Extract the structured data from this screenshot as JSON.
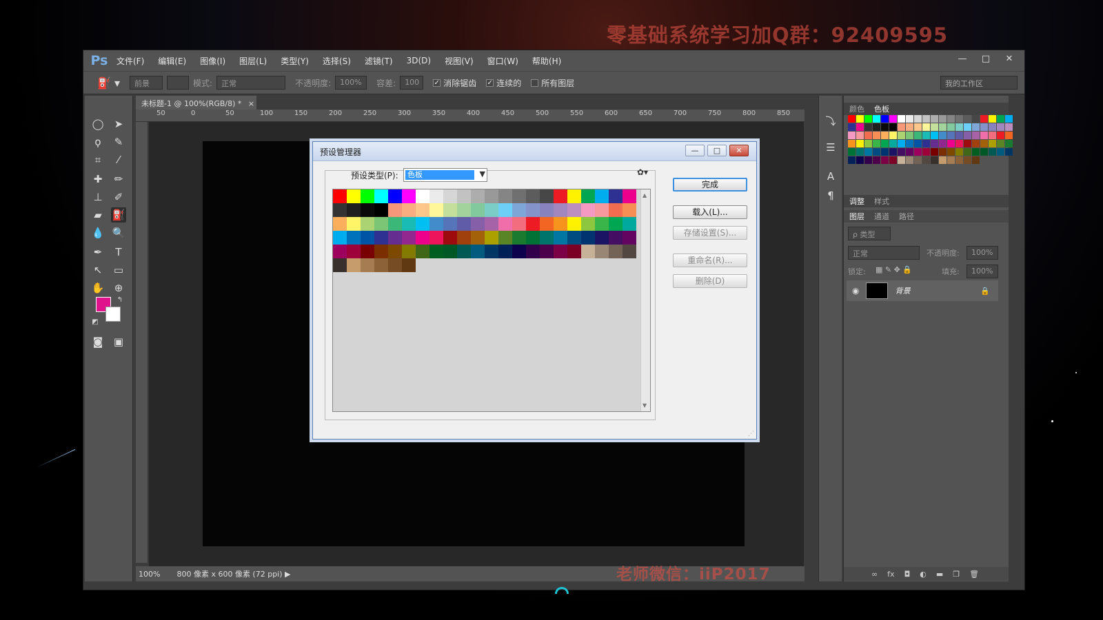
{
  "watermark_top": "零基础系统学习加Q群：92409595",
  "watermark_bottom": "老师微信：iiP2017",
  "app": {
    "logo": "Ps",
    "menus": [
      "文件(F)",
      "编辑(E)",
      "图像(I)",
      "图层(L)",
      "类型(Y)",
      "选择(S)",
      "滤镜(T)",
      "3D(D)",
      "视图(V)",
      "窗口(W)",
      "帮助(H)"
    ],
    "window_controls": {
      "minimize": "—",
      "maximize": "□",
      "close": "✕"
    }
  },
  "options_bar": {
    "fill_source": "前景",
    "mode_label": "模式:",
    "mode_value": "正常",
    "opacity_label": "不透明度:",
    "opacity_value": "100%",
    "tolerance_label": "容差:",
    "tolerance_value": "100",
    "antialias_label": "消除锯齿",
    "contiguous_label": "连续的",
    "all_layers_label": "所有图层",
    "workspace": "我的工作区"
  },
  "document": {
    "tab_title": "未标题-1 @ 100%(RGB/8) *",
    "tab_close": "×",
    "ruler_ticks": [
      "50",
      "0",
      "50",
      "100",
      "150",
      "200",
      "250",
      "300",
      "350",
      "400",
      "450",
      "500",
      "550",
      "600",
      "650",
      "700",
      "750",
      "800",
      "850"
    ],
    "zoom": "100%",
    "doc_info": "800 像素 x 600 像素 (72 ppi)"
  },
  "colors": {
    "foreground": "#e0138c",
    "background": "#ffffff"
  },
  "right_panel": {
    "top_tabs": [
      "颜色",
      "色板"
    ],
    "mid_tabs": [
      "调整",
      "样式"
    ],
    "layer_tabs": [
      "图层",
      "通道",
      "路径"
    ],
    "kind_filter": "ρ 类型",
    "blend_mode": "正常",
    "opacity_label": "不透明度:",
    "opacity_value": "100%",
    "lock_label": "锁定:",
    "fill_label": "填充:",
    "fill_value": "100%",
    "layer_name": "背景"
  },
  "dialog": {
    "title": "预设管理器",
    "preset_type_label": "预设类型(P):",
    "preset_type_value": "色板",
    "buttons": {
      "done": "完成",
      "load": "载入(L)...",
      "save": "存储设置(S)...",
      "rename": "重命名(R)...",
      "delete": "删除(D)"
    }
  },
  "swatches": [
    "#ff0000",
    "#ffff00",
    "#00ff00",
    "#00ffff",
    "#0000ff",
    "#ff00ff",
    "#ffffff",
    "#ebebeb",
    "#d6d6d6",
    "#c2c2c2",
    "#adadad",
    "#999999",
    "#858585",
    "#707070",
    "#5c5c5c",
    "#474747",
    "#ed1c24",
    "#fff200",
    "#00a651",
    "#00aeef",
    "#2e3192",
    "#ec008c",
    "#333333",
    "#1f1f1f",
    "#0a0a0a",
    "#000000",
    "#f7977a",
    "#f9ad81",
    "#fdc68a",
    "#fff79a",
    "#c4df9b",
    "#a3d39c",
    "#82ca9d",
    "#7bcdc8",
    "#6ecff6",
    "#7ea7d8",
    "#8493ca",
    "#8882be",
    "#a187be",
    "#bc8dbf",
    "#f49ac2",
    "#f6989d",
    "#f26c4f",
    "#f68e55",
    "#fbaf5d",
    "#fff467",
    "#acd372",
    "#7cc576",
    "#3bb878",
    "#1abbb4",
    "#00bff3",
    "#438ccb",
    "#5574b9",
    "#605ca8",
    "#855fa8",
    "#a763a8",
    "#f06eaa",
    "#f26d7d",
    "#ed1c24",
    "#f26522",
    "#f7941d",
    "#fff200",
    "#8dc73f",
    "#39b54a",
    "#00a651",
    "#00a99d",
    "#00aeef",
    "#0072bc",
    "#0054a6",
    "#2e3192",
    "#662d91",
    "#92278f",
    "#ec008c",
    "#ed145b",
    "#9e0b0f",
    "#a0410d",
    "#a36209",
    "#aba000",
    "#598527",
    "#1a7b30",
    "#007236",
    "#00746b",
    "#0076a3",
    "#004b80",
    "#003471",
    "#1b1464",
    "#440e62",
    "#630460",
    "#9e005d",
    "#9e0039",
    "#790000",
    "#7b2e00",
    "#7d4900",
    "#827b00",
    "#406618",
    "#005e20",
    "#005826",
    "#005952",
    "#005b7f",
    "#003663",
    "#002157",
    "#0d004c",
    "#32004b",
    "#4b0049",
    "#7b0046",
    "#7a0026",
    "#c7b299",
    "#998675",
    "#736357",
    "#534741",
    "#37302d",
    "#c69c6d",
    "#a67c52",
    "#8c6239",
    "#754c24",
    "#603913"
  ]
}
